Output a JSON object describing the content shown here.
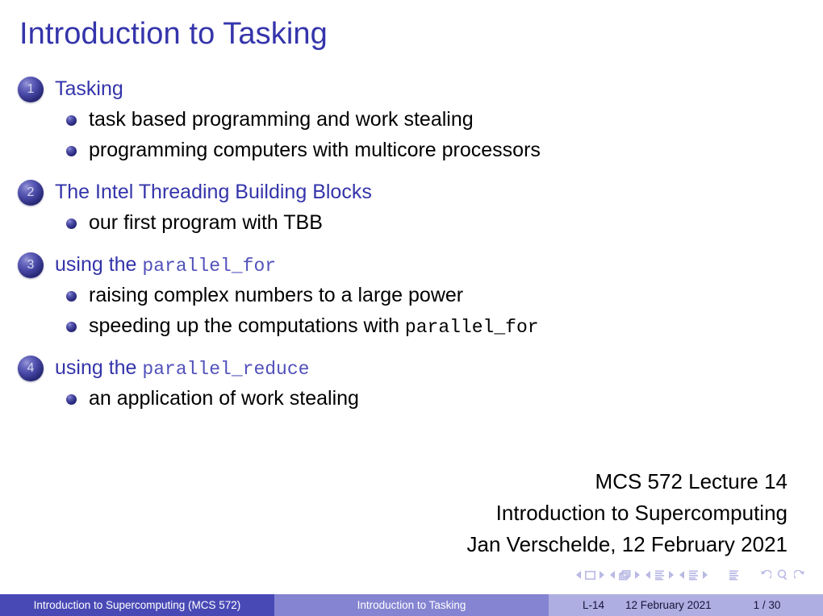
{
  "slide": {
    "title": "Introduction to Tasking",
    "sections": [
      {
        "number": "1",
        "title": "Tasking",
        "mono": "",
        "items": [
          {
            "text": "task based programming and work stealing",
            "mono": ""
          },
          {
            "text": "programming computers with multicore processors",
            "mono": ""
          }
        ]
      },
      {
        "number": "2",
        "title": "The Intel Threading Building Blocks",
        "mono": "",
        "items": [
          {
            "text": "our first program with TBB",
            "mono": ""
          }
        ]
      },
      {
        "number": "3",
        "title": "using the ",
        "mono": "parallel_for",
        "items": [
          {
            "text": "raising complex numbers to a large power",
            "mono": ""
          },
          {
            "text": "speeding up the computations with ",
            "mono": "parallel_for"
          }
        ]
      },
      {
        "number": "4",
        "title": "using the ",
        "mono": "parallel_reduce",
        "items": [
          {
            "text": "an application of work stealing",
            "mono": ""
          }
        ]
      }
    ],
    "lecture_info": {
      "line1": "MCS 572 Lecture 14",
      "line2": "Introduction to Supercomputing",
      "line3": "Jan Verschelde, 12 February 2021"
    },
    "navigation_symbols": [
      "slide-prev-arrow-icon",
      "slide-icon",
      "slide-next-arrow-icon",
      "frame-prev-arrow-icon",
      "frames-icon",
      "frame-next-arrow-icon",
      "subsection-prev-arrow-icon",
      "subsection-icon",
      "subsection-next-arrow-icon",
      "section-prev-arrow-icon",
      "section-icon",
      "section-next-arrow-icon",
      "document-icon",
      "back-icon",
      "search-icon",
      "forward-icon"
    ],
    "footer": {
      "course": "Introduction to Supercomputing  (MCS 572)",
      "section": "Introduction to Tasking",
      "lecture": "L-14",
      "date": "12 February 2021",
      "page": "1 / 30"
    },
    "colors": {
      "title_blue": "#3434ab",
      "mono_blue": "#5151bb",
      "footer_dark": "#4949b6",
      "footer_mid": "#8484d2",
      "footer_light": "#aeaee2",
      "nav_symbol": "#b9b9e4",
      "body_text": "#000000"
    }
  }
}
